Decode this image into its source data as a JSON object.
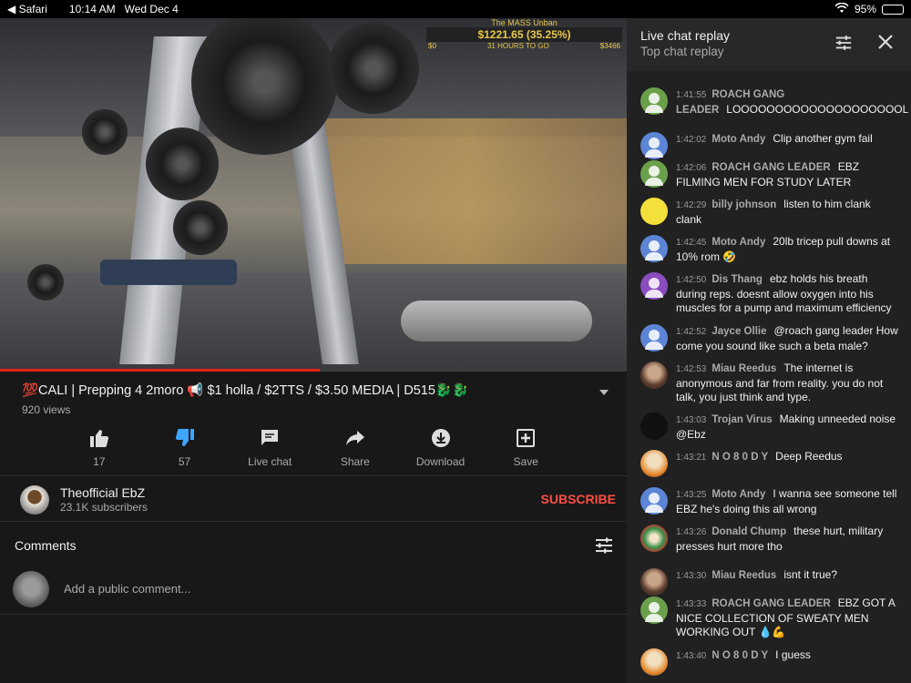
{
  "status_bar": {
    "back_app": "◀ Safari",
    "time": "10:14 AM",
    "date": "Wed Dec 4",
    "battery": "95%"
  },
  "overlay": {
    "title": "The MASS Unban",
    "amount": "$1221.65 (35.25%)",
    "left": "$0",
    "middle": "31 HOURS TO GO",
    "right": "$3466"
  },
  "video": {
    "title": "💯CALI |  Prepping 4 2moro  📢 $1 holla / $2TTS / $3.50 MEDIA |   D515🐉🐉",
    "views": "920 views",
    "progress": 0.51
  },
  "actions": [
    {
      "label": "17",
      "icon": "thumbs-up-icon"
    },
    {
      "label": "57",
      "icon": "thumbs-down-icon"
    },
    {
      "label": "Live chat",
      "icon": "chat-icon"
    },
    {
      "label": "Share",
      "icon": "share-icon"
    },
    {
      "label": "Download",
      "icon": "download-icon"
    },
    {
      "label": "Save",
      "icon": "add-to-playlist-icon"
    }
  ],
  "channel": {
    "name": "Theofficial EbZ",
    "subscribers": "23.1K subscribers",
    "subscribe_label": "SUBSCRIBE"
  },
  "comments": {
    "heading": "Comments",
    "placeholder": "Add a public comment..."
  },
  "chat": {
    "title": "Live chat replay",
    "subtitle": "Top chat replay",
    "messages": [
      {
        "time": "1:41:55",
        "author": "ROACH GANG LEADER",
        "text": "LOOOOOOOOOOOOOOOOOOOOL",
        "avatar": "green"
      },
      {
        "time": "1:42:02",
        "author": "Moto Andy",
        "text": "Clip another gym fail",
        "avatar": "blue"
      },
      {
        "time": "1:42:06",
        "author": "ROACH GANG LEADER",
        "text": "EBZ FILMING MEN FOR STUDY LATER",
        "avatar": "green"
      },
      {
        "time": "1:42:29",
        "author": "billy johnson",
        "text": "listen to him clank clank",
        "avatar": "yellow"
      },
      {
        "time": "1:42:45",
        "author": "Moto Andy",
        "text": "20lb tricep pull downs at 10% rom 🤣",
        "avatar": "blue"
      },
      {
        "time": "1:42:50",
        "author": "Dis Thang",
        "text": "ebz holds his breath during reps. doesnt allow oxygen into his muscles for a pump and maximum efficiency",
        "avatar": "purple"
      },
      {
        "time": "1:42:52",
        "author": "Jayce Ollie",
        "text": "@roach gang leader How come you sound like such a beta male?",
        "avatar": "blue"
      },
      {
        "time": "1:42:53",
        "author": "Miau Reedus",
        "text": "The internet is anonymous and far from reality. you do not talk, you just think and type.",
        "avatar": "photo1"
      },
      {
        "time": "1:43:03",
        "author": "Trojan Virus",
        "text": "Making unneeded noise @Ebz",
        "avatar": "dark"
      },
      {
        "time": "1:43:21",
        "author": "N O 8 0 D Y",
        "text": "Deep Reedus",
        "avatar": "photo2"
      },
      {
        "time": "1:43:25",
        "author": "Moto Andy",
        "text": "I wanna see someone tell EBZ he's doing this all wrong",
        "avatar": "blue"
      },
      {
        "time": "1:43:26",
        "author": "Donald Chump",
        "text": "these hurt, military presses hurt more tho",
        "avatar": "photo3"
      },
      {
        "time": "1:43:30",
        "author": "Miau Reedus",
        "text": "isnt it true?",
        "avatar": "photo1"
      },
      {
        "time": "1:43:33",
        "author": "ROACH GANG LEADER",
        "text": "EBZ GOT A NICE COLLECTION OF SWEATY MEN WORKING OUT 💧💪",
        "avatar": "green"
      },
      {
        "time": "1:43:40",
        "author": "N O 8 0 D Y",
        "text": "I guess",
        "avatar": "photo2"
      }
    ]
  }
}
